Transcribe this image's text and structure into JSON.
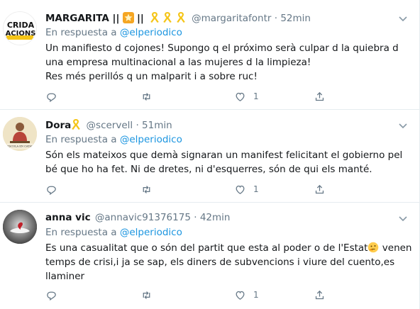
{
  "tweets": [
    {
      "display_name": "MARGARITA ||",
      "name_extra": "||",
      "handle": "@margaritafontr",
      "time": "52min",
      "reply_prefix": "En respuesta a",
      "reply_to": "@elperiodico",
      "lines": [
        "Un manifiesto d cojones! Supongo q el próximo serà culpar d la quiebra d",
        "una empresa multinacional a las mujeres d la limpieza!",
        "Res més perillós q un malparit i a sobre ruc!"
      ],
      "avatar_text": [
        "CRIDA",
        "ACIONS"
      ],
      "likes": "1",
      "emoji": [
        "star-badge",
        "ribbon",
        "ribbon",
        "ribbon"
      ]
    },
    {
      "display_name": "Dora",
      "handle": "@scervell",
      "time": "51min",
      "reply_prefix": "En respuesta a",
      "reply_to": "@elperiodico",
      "lines": [
        "Són els mateixos que demà signaran un manifest felicitant el gobierno pel",
        "bé que ho ha fet. Ni de dretes, ni d'esquerres, són de qui els manté."
      ],
      "avatar_caption": "L'ESCOLA EN CATALÀ",
      "likes": "1",
      "emoji": [
        "ribbon"
      ]
    },
    {
      "display_name": "anna vic",
      "handle": "@annavic91376175",
      "time": "42min",
      "reply_prefix": "En respuesta a",
      "reply_to": "@elperiodico",
      "lines_pre_emoji": "Es una casualitat que o són del partit que esta al poder o de l'Estat",
      "lines_post_emoji": " venen",
      "lines": [
        "temps de crisi,i ja se sap, els diners de subvencions i viure del cuento,es",
        "llaminer"
      ],
      "likes": "1",
      "emoji": [
        "thinking-face"
      ]
    }
  ],
  "colors": {
    "link": "#1b95e0",
    "muted": "#657786",
    "separator": "#e6ecf0",
    "ribbon": "#f5c518"
  }
}
